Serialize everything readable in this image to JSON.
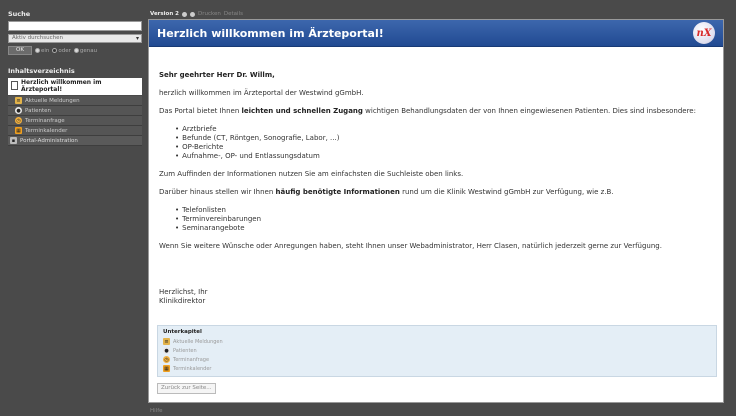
{
  "sidebar": {
    "search_title": "Suche",
    "search_value": "",
    "search_select": "Aktiv durchsuchen",
    "ok_label": "OK",
    "radios": [
      "ein",
      "oder",
      "genau"
    ],
    "toc_title": "Inhaltsverzeichnis",
    "current_page": "Herzlich willkommen im Ärzteportal!",
    "items": [
      {
        "label": "Aktuelle Meldungen",
        "icon": "news-icon"
      },
      {
        "label": "Patienten",
        "icon": "patient-icon"
      },
      {
        "label": "Terminanfrage",
        "icon": "clock-icon"
      },
      {
        "label": "Terminkalender",
        "icon": "calendar-icon"
      }
    ],
    "admin_item": "Portal-Administration"
  },
  "version_bar": {
    "version": "Version 2",
    "links": [
      "Drucken",
      "Details"
    ]
  },
  "banner": {
    "title": "Herzlich willkommen im Ärzteportal!",
    "logo_text": "nX"
  },
  "letter": {
    "greeting": "Sehr geehrter Herr Dr. Willm,",
    "p1": "herzlich willkommen im Ärzteportal der Westwind gGmbH.",
    "p2_pre": "Das Portal bietet Ihnen ",
    "p2_bold": "leichten und schnellen Zugang",
    "p2_post": " wichtigen Behandlungsdaten der von Ihnen eingewiesenen Patienten. Dies sind insbesondere:",
    "list1": [
      "Arztbriefe",
      "Befunde (CT, Röntgen, Sonografie, Labor, ...)",
      "OP-Berichte",
      "Aufnahme-, OP- und Entlassungsdatum"
    ],
    "p3": "Zum Auffinden der Informationen nutzen Sie am einfachsten die Suchleiste oben links.",
    "p4_pre": "Darüber hinaus stellen wir Ihnen ",
    "p4_bold": "häufig benötigte Informationen",
    "p4_post": " rund um die Klinik Westwind gGmbH zur Verfügung, wie z.B.",
    "list2": [
      "Telefonlisten",
      "Terminvereinbarungen",
      "Seminarangebote"
    ],
    "p5": "Wenn Sie weitere Wünsche oder Anregungen haben, steht Ihnen unser Webadministrator, Herr Clasen, natürlich jederzeit gerne zur Verfügung.",
    "closing1": "Herzlichst, Ihr",
    "closing2": "Klinikdirektor"
  },
  "subchapter": {
    "title": "Unterkapitel",
    "items": [
      {
        "label": "Aktuelle Meldungen",
        "icon": "news-icon"
      },
      {
        "label": "Patienten",
        "icon": "patient-icon"
      },
      {
        "label": "Terminanfrage",
        "icon": "clock-icon"
      },
      {
        "label": "Terminkalender",
        "icon": "calendar-icon"
      }
    ]
  },
  "back_button": "Zurück zur Seite...",
  "footer": "Hilfe"
}
